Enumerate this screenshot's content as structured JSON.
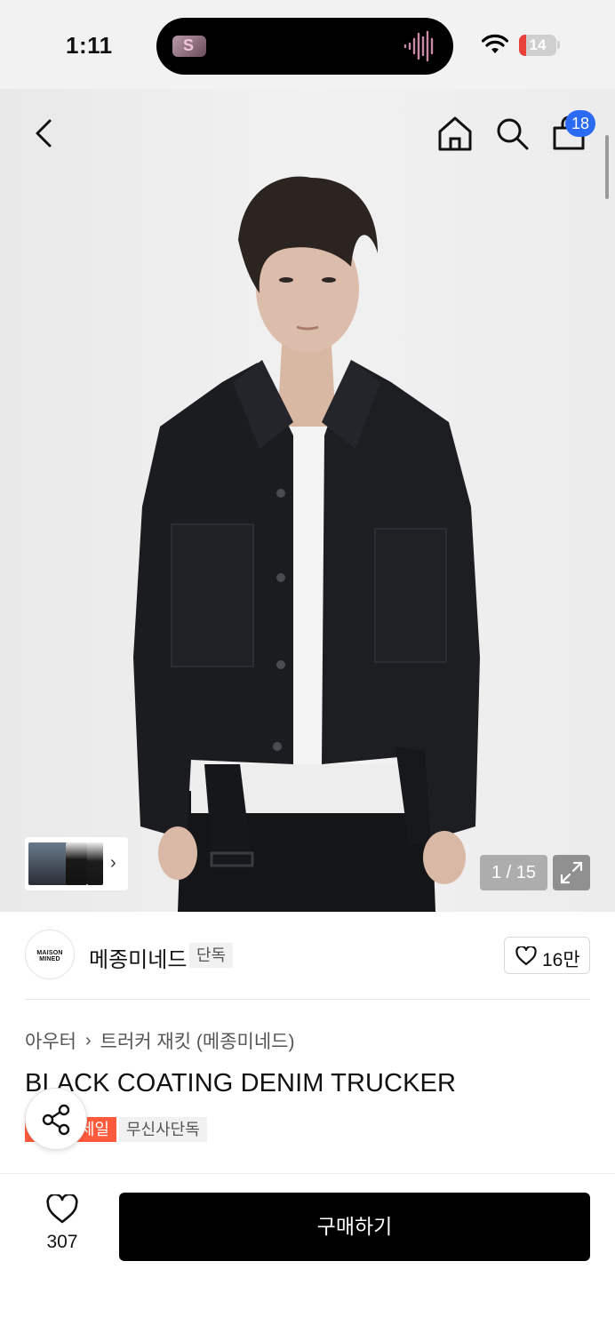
{
  "status_bar": {
    "time": "1:11",
    "battery": "14"
  },
  "header": {
    "cart_count": "18"
  },
  "gallery": {
    "counter": "1 / 15"
  },
  "brand": {
    "logo_text": "MAISON MINED",
    "name": "메종미네드",
    "tag": "단독",
    "favorite_count": "16만"
  },
  "product": {
    "breadcrumb": [
      "아우터",
      "트러커 재킷 (메종미네드)"
    ],
    "title": "BLACK COATING DENIM TRUCKER",
    "badges": {
      "sale": "세일",
      "exclusive": "무신사단독"
    }
  },
  "bottom_bar": {
    "like_count": "307",
    "buy_label": "구매하기"
  },
  "icons": [
    "back-icon",
    "home-icon",
    "search-icon",
    "bag-icon",
    "share-icon",
    "heart-icon",
    "expand-icon",
    "chevron-right-icon",
    "wifi-icon"
  ],
  "colors": {
    "accent_badge": "#2b6af5",
    "sale_badge": "#ff5a3c",
    "buy_button": "#000000"
  }
}
